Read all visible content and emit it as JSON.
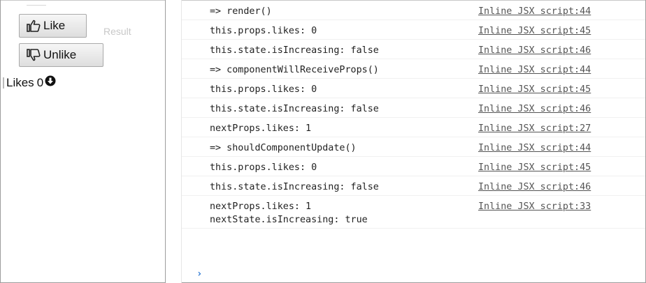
{
  "result_pane": {
    "like_button": {
      "label": "Like",
      "icon": "thumbs-up-icon"
    },
    "unlike_button": {
      "label": "Unlike",
      "icon": "thumbs-down-icon"
    },
    "watermark": "Result",
    "likes": {
      "label": "Likes",
      "count": "0",
      "icon": "circle-arrow-down-icon"
    }
  },
  "console": {
    "rows": [
      {
        "message": "=> render()",
        "source": "Inline JSX script:44"
      },
      {
        "message": "this.props.likes: 0",
        "source": "Inline JSX script:45"
      },
      {
        "message": "this.state.isIncreasing: false",
        "source": "Inline JSX script:46"
      },
      {
        "message": "=> componentWillReceiveProps()",
        "source": "Inline JSX script:44"
      },
      {
        "message": "this.props.likes: 0",
        "source": "Inline JSX script:45"
      },
      {
        "message": "this.state.isIncreasing: false",
        "source": "Inline JSX script:46"
      },
      {
        "message": "nextProps.likes: 1",
        "source": "Inline JSX script:27"
      },
      {
        "message": "=> shouldComponentUpdate()",
        "source": "Inline JSX script:44"
      },
      {
        "message": "this.props.likes: 0",
        "source": "Inline JSX script:45"
      },
      {
        "message": "this.state.isIncreasing: false",
        "source": "Inline JSX script:46"
      },
      {
        "message": "nextProps.likes: 1\nnextState.isIncreasing: true",
        "source": "Inline JSX script:33"
      }
    ],
    "prompt_symbol": "›",
    "prompt_color": "#2a76d2"
  }
}
